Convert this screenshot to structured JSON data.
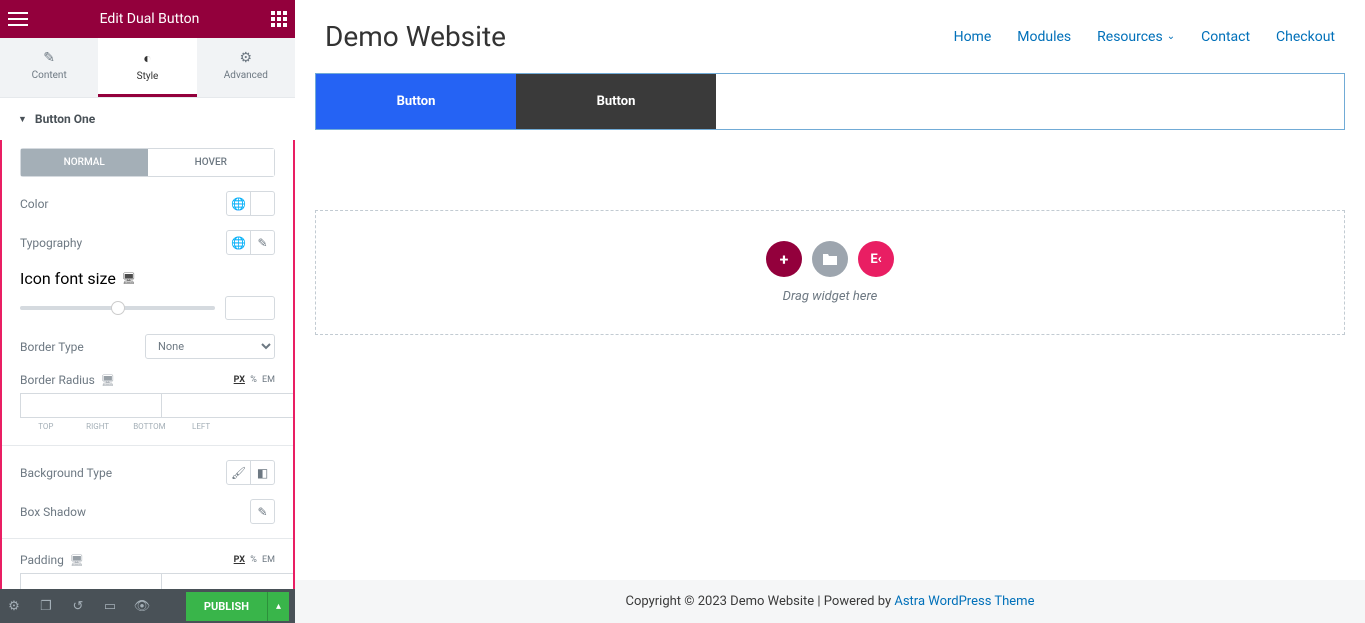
{
  "header": {
    "title": "Edit Dual Button"
  },
  "tabs": {
    "content": "Content",
    "style": "Style",
    "advanced": "Advanced"
  },
  "section": {
    "title": "Button One"
  },
  "stateTabs": {
    "normal": "NORMAL",
    "hover": "HOVER"
  },
  "controls": {
    "color": "Color",
    "typography": "Typography",
    "iconFontSize": "Icon font size",
    "borderType": "Border Type",
    "borderTypeValue": "None",
    "borderRadius": "Border Radius",
    "backgroundType": "Background Type",
    "boxShadow": "Box Shadow",
    "padding": "Padding"
  },
  "units": {
    "px": "PX",
    "pct": "%",
    "em": "EM"
  },
  "dimensions": {
    "top": "TOP",
    "right": "RIGHT",
    "bottom": "BOTTOM",
    "left": "LEFT"
  },
  "footer": {
    "publish": "PUBLISH"
  },
  "preview": {
    "siteTitle": "Demo Website",
    "nav": {
      "home": "Home",
      "modules": "Modules",
      "resources": "Resources",
      "contact": "Contact",
      "checkout": "Checkout"
    },
    "buttonOne": "Button",
    "buttonTwo": "Button",
    "dropText": "Drag widget here",
    "footerText": "Copyright © 2023 Demo Website | Powered by ",
    "footerLink": "Astra WordPress Theme"
  },
  "icons": {
    "plus": "+",
    "ek": "E‹"
  }
}
